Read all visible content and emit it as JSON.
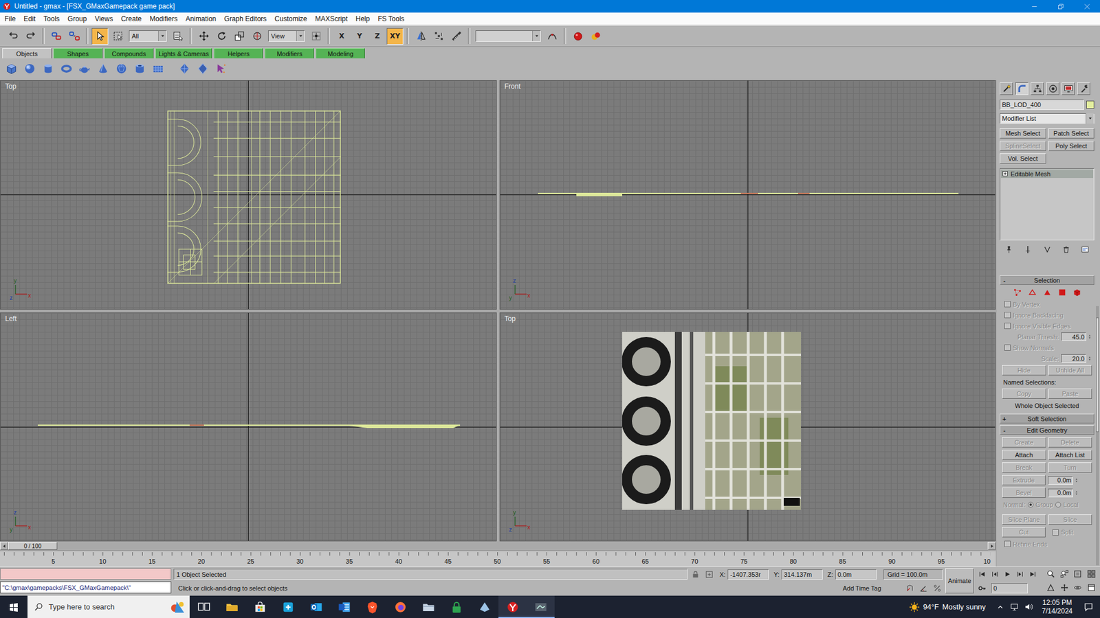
{
  "window": {
    "title": "Untitled - gmax - [FSX_GMaxGamepack game pack]"
  },
  "menu": [
    "File",
    "Edit",
    "Tools",
    "Group",
    "Views",
    "Create",
    "Modifiers",
    "Animation",
    "Graph Editors",
    "Customize",
    "MAXScript",
    "Help",
    "FS Tools"
  ],
  "toolbar": [
    {
      "kind": "undo",
      "selected": false
    },
    {
      "kind": "redo",
      "selected": false
    },
    {
      "kind": "link",
      "selected": false
    },
    {
      "kind": "unlink",
      "selected": false
    },
    {
      "kind": "select",
      "selected": true
    },
    {
      "kind": "region",
      "selected": false
    },
    {
      "kind": "filter-dropdown",
      "text": "All"
    },
    {
      "kind": "select-name",
      "selected": false
    },
    {
      "kind": "move",
      "selected": false
    },
    {
      "kind": "rotate",
      "selected": false
    },
    {
      "kind": "scale",
      "selected": false
    },
    {
      "kind": "manipulate",
      "selected": false
    },
    {
      "kind": "coord-dropdown",
      "text": "View"
    },
    {
      "kind": "pivot",
      "selected": false
    },
    {
      "kind": "axis",
      "text": "X",
      "selected": false
    },
    {
      "kind": "axis",
      "text": "Y",
      "selected": false
    },
    {
      "kind": "axis",
      "text": "Z",
      "selected": false
    },
    {
      "kind": "axis",
      "text": "XY",
      "selected": true
    },
    {
      "kind": "mirror",
      "selected": false
    },
    {
      "kind": "array",
      "selected": false
    },
    {
      "kind": "measure",
      "selected": false
    },
    {
      "kind": "named-dropdown"
    },
    {
      "kind": "named-set",
      "selected": false
    },
    {
      "kind": "render",
      "selected": false
    },
    {
      "kind": "quick-render",
      "selected": false
    }
  ],
  "tabs": [
    {
      "label": "Objects",
      "selected": true
    },
    {
      "label": "Shapes",
      "selected": false
    },
    {
      "label": "Compounds",
      "selected": false
    },
    {
      "label": "Lights & Cameras",
      "selected": false
    },
    {
      "label": "Helpers",
      "selected": false
    },
    {
      "label": "Modifiers",
      "selected": false
    },
    {
      "label": "Modeling",
      "selected": false
    }
  ],
  "create_buttons": [
    {
      "kind": "box"
    },
    {
      "kind": "sphere"
    },
    {
      "kind": "cylinder"
    },
    {
      "kind": "torus"
    },
    {
      "kind": "teapot"
    },
    {
      "kind": "cone"
    },
    {
      "kind": "geosphere"
    },
    {
      "kind": "tube"
    },
    {
      "kind": "plane"
    },
    {
      "kind": "hedra"
    },
    {
      "kind": "chamfer"
    },
    {
      "kind": "particle"
    }
  ],
  "viewports": [
    {
      "label": "Top",
      "kind": "wire-top",
      "tripod": [
        "y",
        "z",
        "x"
      ]
    },
    {
      "label": "Front",
      "kind": "wire-front",
      "tripod": [
        "z",
        "y",
        "x"
      ]
    },
    {
      "label": "Left",
      "kind": "wire-left",
      "tripod": [
        "z",
        "y",
        "x"
      ]
    },
    {
      "label": "Top",
      "kind": "textured",
      "tripod": [
        "y",
        "z",
        "x"
      ]
    }
  ],
  "time_slider": {
    "text": "0 / 100",
    "level": 0
  },
  "ruler": [
    "5",
    "10",
    "15",
    "20",
    "25",
    "30",
    "35",
    "40",
    "45",
    "50",
    "55",
    "60",
    "65",
    "70",
    "75",
    "80",
    "85",
    "90",
    "95",
    "10"
  ],
  "command_panel": {
    "tabs": [
      {
        "kind": "create",
        "selected": false
      },
      {
        "kind": "modify",
        "selected": true
      },
      {
        "kind": "hierarchy",
        "selected": false
      },
      {
        "kind": "motion",
        "selected": false
      },
      {
        "kind": "display",
        "selected": false
      },
      {
        "kind": "utilities",
        "selected": false
      }
    ],
    "object_name": "BB_LOD_400",
    "modifier_list": "Modifier List",
    "modifier_buttons": [
      {
        "label": "Mesh Select",
        "disabled": false
      },
      {
        "label": "Patch Select",
        "disabled": false
      },
      {
        "label": "SplineSelect",
        "disabled": true
      },
      {
        "label": "Poly Select",
        "disabled": false
      },
      {
        "label": "Vol. Select",
        "disabled": false
      }
    ],
    "stack": [
      {
        "label": "Editable Mesh",
        "selected": true
      }
    ],
    "rollouts": [
      {
        "title": "Selection",
        "sign": "-",
        "expanded": true,
        "rows": [
          {
            "kind": "levels",
            "items": [
              {
                "kind": "vertex",
                "selected": false
              },
              {
                "kind": "edge",
                "selected": false
              },
              {
                "kind": "face",
                "selected": false
              },
              {
                "kind": "polygon",
                "selected": false
              },
              {
                "kind": "element",
                "selected": false
              }
            ]
          },
          {
            "kind": "checkbox",
            "label": "By Vertex",
            "checked": false,
            "disabled": true
          },
          {
            "kind": "checkbox",
            "label": "Ignore Backfacing",
            "checked": false,
            "disabled": true
          },
          {
            "kind": "checkbox",
            "label": "Ignore Visible Edges",
            "checked": false,
            "disabled": true
          },
          {
            "kind": "spinner",
            "label": "Planar Thresh:",
            "value": "45.0",
            "disabled": true
          },
          {
            "kind": "checkbox",
            "label": "Show Normals",
            "checked": false,
            "disabled": true
          },
          {
            "kind": "spinner",
            "label": "Scale:",
            "value": "20.0",
            "disabled": true
          },
          {
            "kind": "buttons",
            "items": [
              {
                "label": "Hide",
                "disabled": true
              },
              {
                "label": "Unhide All",
                "disabled": true
              }
            ]
          },
          {
            "kind": "label",
            "text": "Named Selections:"
          },
          {
            "kind": "buttons",
            "items": [
              {
                "label": "Copy",
                "disabled": true
              },
              {
                "label": "Paste",
                "disabled": true
              }
            ]
          },
          {
            "kind": "note",
            "text": "Whole Object Selected"
          }
        ]
      },
      {
        "title": "Soft Selection",
        "sign": "+",
        "expanded": false,
        "rows": []
      },
      {
        "title": "Edit Geometry",
        "sign": "-",
        "expanded": true,
        "rows": [
          {
            "kind": "buttons",
            "items": [
              {
                "label": "Create",
                "disabled": true
              },
              {
                "label": "Delete",
                "disabled": true
              }
            ]
          },
          {
            "kind": "buttons",
            "items": [
              {
                "label": "Attach",
                "disabled": false
              },
              {
                "label": "Attach List",
                "disabled": false
              }
            ]
          },
          {
            "kind": "buttons",
            "items": [
              {
                "label": "Break",
                "disabled": true
              },
              {
                "label": "Turn",
                "disabled": true
              }
            ]
          },
          {
            "kind": "spinner-button",
            "label": "Extrude",
            "value": "0.0m",
            "disabled": true
          },
          {
            "kind": "spinner-button",
            "label": "Bevel",
            "value": "0.0m",
            "disabled": true
          },
          {
            "kind": "radio",
            "label": "Normal:",
            "disabled": true,
            "items": [
              {
                "label": "Group",
                "selected": true
              },
              {
                "label": "Local",
                "selected": false
              }
            ]
          },
          {
            "kind": "buttons",
            "items": [
              {
                "label": "Slice Plane",
                "disabled": true
              },
              {
                "label": "Slice",
                "disabled": true
              }
            ]
          },
          {
            "kind": "button-check",
            "button": {
              "label": "Cut",
              "disabled": true
            },
            "check": {
              "label": "Split",
              "checked": false,
              "disabled": true
            }
          },
          {
            "kind": "checkbox",
            "label": "Refine Ends",
            "checked": false,
            "disabled": true
          }
        ]
      }
    ]
  },
  "status": {
    "listener": "\"C:\\gmax\\gamepacks\\FSX_GMaxGamepack\\\"",
    "selection": "1 Object Selected",
    "prompt": "Click or click-and-drag to select objects",
    "coords": [
      {
        "axis": "X:",
        "value": "-1407.353r"
      },
      {
        "axis": "Y:",
        "value": "314.137m"
      },
      {
        "axis": "Z:",
        "value": "0.0m"
      }
    ],
    "grid": "Grid = 100.0m",
    "animate": "Animate",
    "time_tag": "Add Time Tag",
    "frame": "0"
  },
  "taskbar": {
    "search": "Type here to search",
    "apps": [
      {
        "kind": "task-view",
        "selected": false
      },
      {
        "kind": "explorer",
        "selected": false
      },
      {
        "kind": "store",
        "selected": false
      },
      {
        "kind": "app-blue",
        "selected": false
      },
      {
        "kind": "outlook",
        "selected": false
      },
      {
        "kind": "word",
        "selected": false
      },
      {
        "kind": "brave",
        "selected": false
      },
      {
        "kind": "firefox",
        "selected": false
      },
      {
        "kind": "files",
        "selected": false
      },
      {
        "kind": "lock",
        "selected": false
      },
      {
        "kind": "app",
        "selected": false
      },
      {
        "kind": "gmax",
        "selected": true
      },
      {
        "kind": "game",
        "selected": true
      }
    ],
    "weather": {
      "temp": "94°F",
      "text": "Mostly sunny"
    },
    "time": "12:05 PM",
    "date": "7/14/2024"
  }
}
